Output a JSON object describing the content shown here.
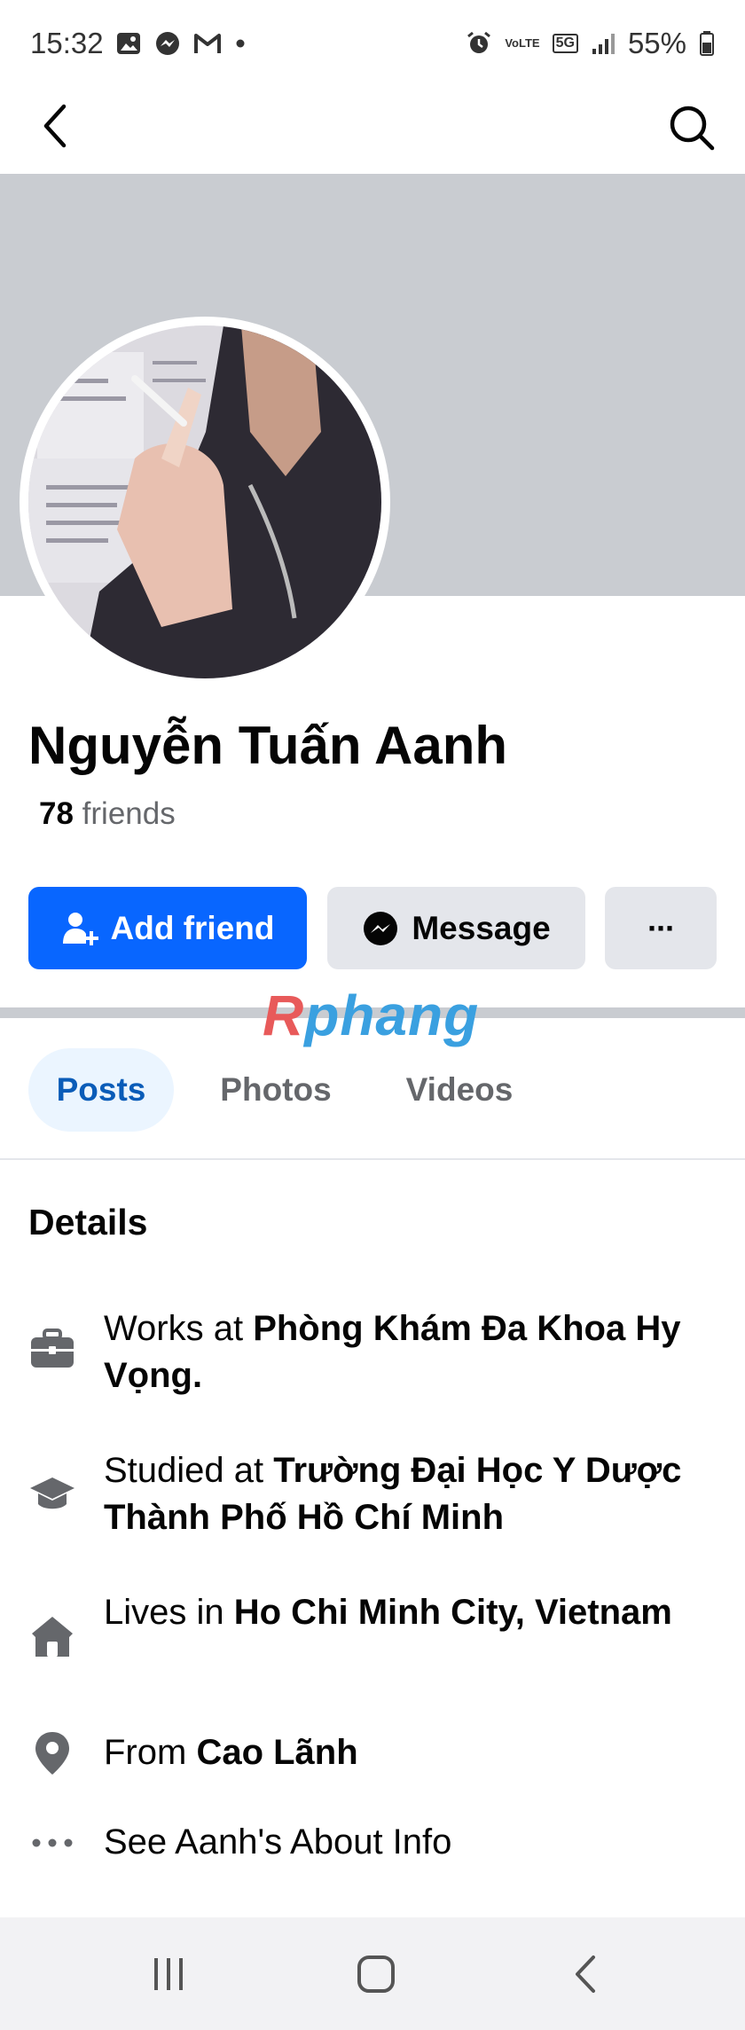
{
  "status_bar": {
    "time": "15:32",
    "battery": "55%",
    "left_icons": [
      "gallery-icon",
      "messenger-icon",
      "gmail-icon",
      "dot-icon"
    ],
    "right_icons": [
      "alarm-icon",
      "volte-icon",
      "5g-icon",
      "signal-icon",
      "battery-icon"
    ],
    "volte_label": "VoLTE",
    "network_label": "5G"
  },
  "nav": {
    "back_icon": "chevron-left-icon",
    "search_icon": "search-icon"
  },
  "profile": {
    "name": "Nguyễn Tuấn Aanh",
    "friends_count": "78",
    "friends_label": "friends"
  },
  "actions": {
    "add_friend": "Add friend",
    "message": "Message",
    "more": "···"
  },
  "watermark": {
    "first": "R",
    "rest": "phang"
  },
  "tabs": [
    {
      "label": "Posts",
      "active": true
    },
    {
      "label": "Photos",
      "active": false
    },
    {
      "label": "Videos",
      "active": false
    }
  ],
  "details": {
    "title": "Details",
    "items": [
      {
        "icon": "briefcase-icon",
        "prefix": "Works at ",
        "value": "Phòng Khám Đa Khoa Hy Vọng."
      },
      {
        "icon": "graduation-cap-icon",
        "prefix": "Studied at ",
        "value": "Trường Đại Học Y Dược Thành Phố Hồ Chí Minh"
      },
      {
        "icon": "home-icon",
        "prefix": "Lives in ",
        "value": "Ho Chi Minh City, Vietnam"
      },
      {
        "icon": "location-pin-icon",
        "prefix": "From ",
        "value": "Cao Lãnh"
      },
      {
        "icon": "more-dots-icon",
        "prefix": "See Aanh's About Info",
        "value": ""
      }
    ]
  },
  "colors": {
    "accent": "#0866ff",
    "cover": "#c9ccd1",
    "button_secondary": "#e4e6eb",
    "text_secondary": "#65676b"
  }
}
